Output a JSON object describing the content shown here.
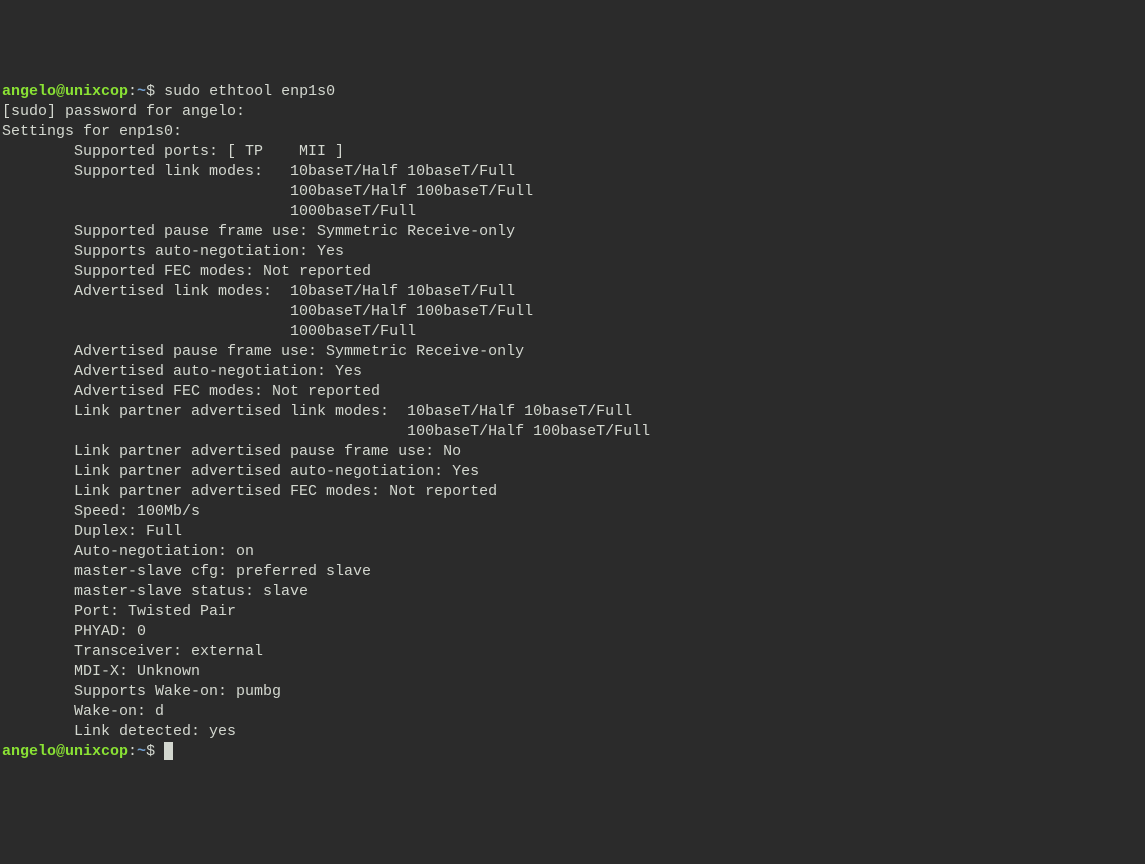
{
  "prompt1": {
    "user": "angelo@unixcop",
    "colon": ":",
    "path": "~",
    "dollar": "$ ",
    "command": "sudo ethtool enp1s0"
  },
  "lines": [
    "[sudo] password for angelo: ",
    "Settings for enp1s0:",
    "        Supported ports: [ TP    MII ]",
    "        Supported link modes:   10baseT/Half 10baseT/Full",
    "                                100baseT/Half 100baseT/Full",
    "                                1000baseT/Full",
    "        Supported pause frame use: Symmetric Receive-only",
    "        Supports auto-negotiation: Yes",
    "        Supported FEC modes: Not reported",
    "        Advertised link modes:  10baseT/Half 10baseT/Full",
    "                                100baseT/Half 100baseT/Full",
    "                                1000baseT/Full",
    "        Advertised pause frame use: Symmetric Receive-only",
    "        Advertised auto-negotiation: Yes",
    "        Advertised FEC modes: Not reported",
    "        Link partner advertised link modes:  10baseT/Half 10baseT/Full",
    "                                             100baseT/Half 100baseT/Full",
    "        Link partner advertised pause frame use: No",
    "        Link partner advertised auto-negotiation: Yes",
    "        Link partner advertised FEC modes: Not reported",
    "        Speed: 100Mb/s",
    "        Duplex: Full",
    "        Auto-negotiation: on",
    "        master-slave cfg: preferred slave",
    "        master-slave status: slave",
    "        Port: Twisted Pair",
    "        PHYAD: 0",
    "        Transceiver: external",
    "        MDI-X: Unknown",
    "        Supports Wake-on: pumbg",
    "        Wake-on: d",
    "        Link detected: yes"
  ],
  "prompt2": {
    "user": "angelo@unixcop",
    "colon": ":",
    "path": "~",
    "dollar": "$ "
  }
}
